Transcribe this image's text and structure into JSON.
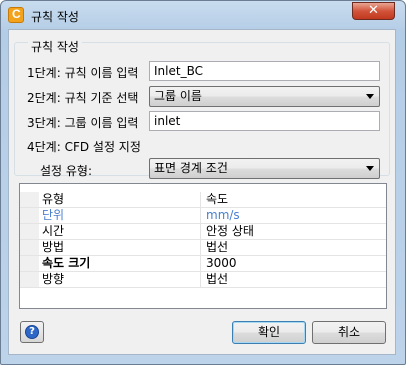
{
  "window": {
    "title": "규칙 작성",
    "app_icon_letter": "C",
    "close_glyph": "✕"
  },
  "group": {
    "legend": "규칙 작성",
    "step1": {
      "label": "1단계: 규칙 이름 입력",
      "value": "Inlet_BC"
    },
    "step2": {
      "label": "2단계: 규칙 기준 선택",
      "value": "그룹 이름"
    },
    "step3": {
      "label": "3단계: 그룹 이름 입력",
      "value": "inlet"
    },
    "step4": {
      "label": "4단계: CFD 설정 지정"
    },
    "setting_type": {
      "label": "설정 유형:",
      "value": "표면 경계 조건"
    }
  },
  "grid": {
    "rows": [
      {
        "name": "유형",
        "value": "속도"
      },
      {
        "name": "단위",
        "value": "mm/s"
      },
      {
        "name": "시간",
        "value": "안정 상태"
      },
      {
        "name": "방법",
        "value": "법선"
      },
      {
        "name": "속도 크기",
        "value": "3000"
      },
      {
        "name": "방향",
        "value": "법선"
      }
    ]
  },
  "buttons": {
    "help": "?",
    "ok": "확인",
    "cancel": "취소"
  },
  "colors": {
    "unit_row": "#4a7fcf",
    "close_button": "#c0381f",
    "app_icon": "#f3a21c"
  }
}
